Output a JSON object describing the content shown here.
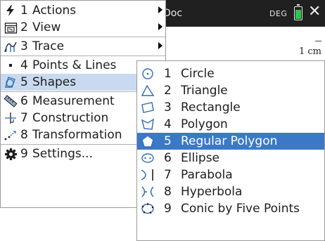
{
  "titlebar": {
    "doc_title": "Doc",
    "angle_mode": "DEG",
    "close_glyph": "✕"
  },
  "canvas": {
    "scale_label": "1 cm"
  },
  "main_menu": {
    "items": [
      {
        "num": "1",
        "label": "Actions",
        "icon": "lightning-icon",
        "submenu": true
      },
      {
        "num": "2",
        "label": "View",
        "icon": "view-icon",
        "submenu": true
      },
      {
        "num": "3",
        "label": "Trace",
        "icon": "trace-icon",
        "submenu": true
      },
      {
        "num": "4",
        "label": "Points & Lines",
        "icon": "point-icon",
        "submenu": true
      },
      {
        "num": "5",
        "label": "Shapes",
        "icon": "shapes-icon",
        "submenu": true,
        "selected": true
      },
      {
        "num": "6",
        "label": "Measurement",
        "icon": "ruler-icon",
        "submenu": true
      },
      {
        "num": "7",
        "label": "Construction",
        "icon": "construction-icon",
        "submenu": true
      },
      {
        "num": "8",
        "label": "Transformation",
        "icon": "transformation-icon",
        "submenu": true
      },
      {
        "num": "9",
        "label": "Settings...",
        "icon": "gear-icon",
        "submenu": false
      }
    ]
  },
  "sub_menu": {
    "items": [
      {
        "num": "1",
        "label": "Circle",
        "icon": "circle-icon"
      },
      {
        "num": "2",
        "label": "Triangle",
        "icon": "triangle-icon"
      },
      {
        "num": "3",
        "label": "Rectangle",
        "icon": "rectangle-icon"
      },
      {
        "num": "4",
        "label": "Polygon",
        "icon": "polygon-icon"
      },
      {
        "num": "5",
        "label": "Regular Polygon",
        "icon": "regular-polygon-icon",
        "selected": true
      },
      {
        "num": "6",
        "label": "Ellipse",
        "icon": "ellipse-icon"
      },
      {
        "num": "7",
        "label": "Parabola",
        "icon": "parabola-icon"
      },
      {
        "num": "8",
        "label": "Hyperbola",
        "icon": "hyperbola-icon"
      },
      {
        "num": "9",
        "label": "Conic by Five Points",
        "icon": "conic-icon"
      }
    ]
  },
  "colors": {
    "titlebar": "#202020",
    "selection_primary": "#3b79c6",
    "selection_secondary": "#c9daf0",
    "icon_blue": "#2f6db5",
    "battery": "#2cc64f"
  }
}
